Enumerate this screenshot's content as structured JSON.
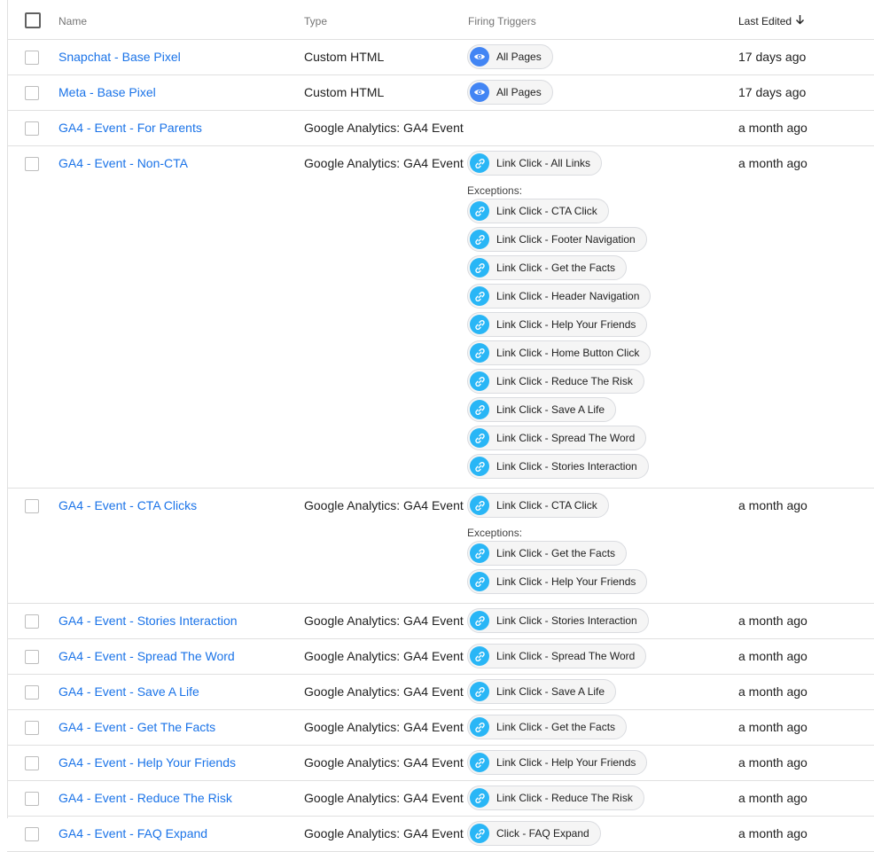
{
  "header": {
    "name": "Name",
    "type": "Type",
    "triggers": "Firing Triggers",
    "last_edited": "Last Edited"
  },
  "exceptions_label": "Exceptions:",
  "rows": [
    {
      "name": "Snapchat - Base Pixel",
      "type": "Custom HTML",
      "triggers": [
        {
          "icon": "eye-icon",
          "label": "All Pages"
        }
      ],
      "exceptions": [],
      "edited": "17 days ago"
    },
    {
      "name": "Meta - Base Pixel",
      "type": "Custom HTML",
      "triggers": [
        {
          "icon": "eye-icon",
          "label": "All Pages"
        }
      ],
      "exceptions": [],
      "edited": "17 days ago"
    },
    {
      "name": "GA4 - Event - For Parents",
      "type": "Google Analytics: GA4 Event",
      "triggers": [],
      "exceptions": [],
      "edited": "a month ago"
    },
    {
      "name": "GA4 - Event - Non-CTA",
      "type": "Google Analytics: GA4 Event",
      "triggers": [
        {
          "icon": "link-icon",
          "label": "Link Click - All Links"
        }
      ],
      "exceptions": [
        {
          "icon": "link-icon",
          "label": "Link Click - CTA Click"
        },
        {
          "icon": "link-icon",
          "label": "Link Click - Footer Navigation"
        },
        {
          "icon": "link-icon",
          "label": "Link Click - Get the Facts"
        },
        {
          "icon": "link-icon",
          "label": "Link Click - Header Navigation"
        },
        {
          "icon": "link-icon",
          "label": "Link Click - Help Your Friends"
        },
        {
          "icon": "link-icon",
          "label": "Link Click - Home Button Click"
        },
        {
          "icon": "link-icon",
          "label": "Link Click - Reduce The Risk"
        },
        {
          "icon": "link-icon",
          "label": "Link Click - Save A Life"
        },
        {
          "icon": "link-icon",
          "label": "Link Click - Spread The Word"
        },
        {
          "icon": "link-icon",
          "label": "Link Click - Stories Interaction"
        }
      ],
      "edited": "a month ago"
    },
    {
      "name": "GA4 - Event - CTA Clicks",
      "type": "Google Analytics: GA4 Event",
      "triggers": [
        {
          "icon": "link-icon",
          "label": "Link Click - CTA Click"
        }
      ],
      "exceptions": [
        {
          "icon": "link-icon",
          "label": "Link Click - Get the Facts"
        },
        {
          "icon": "link-icon",
          "label": "Link Click - Help Your Friends"
        }
      ],
      "edited": "a month ago"
    },
    {
      "name": "GA4 - Event - Stories Interaction",
      "type": "Google Analytics: GA4 Event",
      "triggers": [
        {
          "icon": "link-icon",
          "label": "Link Click - Stories Interaction"
        }
      ],
      "exceptions": [],
      "edited": "a month ago"
    },
    {
      "name": "GA4 - Event - Spread The Word",
      "type": "Google Analytics: GA4 Event",
      "triggers": [
        {
          "icon": "link-icon",
          "label": "Link Click - Spread The Word"
        }
      ],
      "exceptions": [],
      "edited": "a month ago"
    },
    {
      "name": "GA4 - Event - Save A Life",
      "type": "Google Analytics: GA4 Event",
      "triggers": [
        {
          "icon": "link-icon",
          "label": "Link Click - Save A Life"
        }
      ],
      "exceptions": [],
      "edited": "a month ago"
    },
    {
      "name": "GA4 - Event - Get The Facts",
      "type": "Google Analytics: GA4 Event",
      "triggers": [
        {
          "icon": "link-icon",
          "label": "Link Click - Get the Facts"
        }
      ],
      "exceptions": [],
      "edited": "a month ago"
    },
    {
      "name": "GA4 - Event - Help Your Friends",
      "type": "Google Analytics: GA4 Event",
      "triggers": [
        {
          "icon": "link-icon",
          "label": "Link Click - Help Your Friends"
        }
      ],
      "exceptions": [],
      "edited": "a month ago"
    },
    {
      "name": "GA4 - Event - Reduce The Risk",
      "type": "Google Analytics: GA4 Event",
      "triggers": [
        {
          "icon": "link-icon",
          "label": "Link Click - Reduce The Risk"
        }
      ],
      "exceptions": [],
      "edited": "a month ago"
    },
    {
      "name": "GA4 - Event - FAQ Expand",
      "type": "Google Analytics: GA4 Event",
      "triggers": [
        {
          "icon": "link-icon",
          "label": "Click - FAQ Expand"
        }
      ],
      "exceptions": [],
      "edited": "a month ago"
    }
  ],
  "colors": {
    "link": "#1a73e8",
    "eye_icon_bg": "#4285f4",
    "link_icon_bg": "#29b6f6",
    "chip_bg": "#f5f5f5",
    "border": "#e0e0e0"
  }
}
